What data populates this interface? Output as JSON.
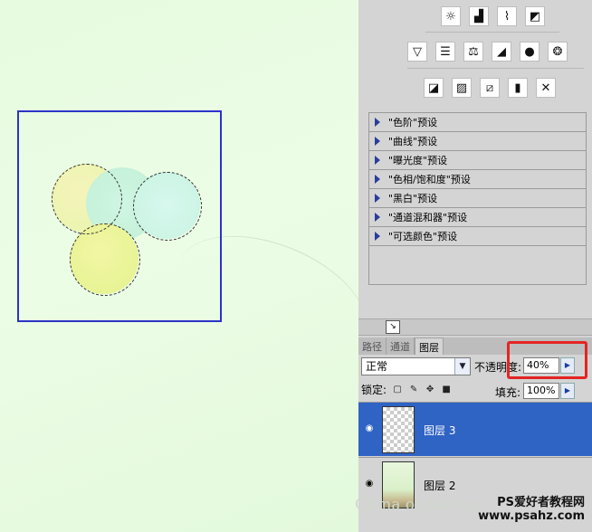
{
  "adjustments": {
    "row1_icons": [
      "brightness-icon",
      "levels-icon",
      "curves-icon",
      "exposure-icon"
    ],
    "row2_icons": [
      "vibrance-icon",
      "hue-saturation-icon",
      "color-balance-icon",
      "black-white-icon",
      "photo-filter-icon",
      "channel-mixer-icon"
    ],
    "row3_icons": [
      "invert-icon",
      "posterize-icon",
      "threshold-icon",
      "gradient-map-icon",
      "selective-color-icon"
    ],
    "presets": [
      "\"色阶\"预设",
      "\"曲线\"预设",
      "\"曝光度\"预设",
      "\"色相/饱和度\"预设",
      "\"黑白\"预设",
      "\"通道混和器\"预设",
      "\"可选颜色\"预设"
    ]
  },
  "layers_panel": {
    "tabs": [
      "路径",
      "通道",
      "图层"
    ],
    "active_tab": "图层",
    "blend_mode": "正常",
    "opacity_label": "不透明度:",
    "opacity_value": "40%",
    "lock_label": "锁定:",
    "fill_label": "填充:",
    "fill_value": "100%",
    "layers": [
      {
        "name": "图层 3",
        "selected": true
      },
      {
        "name": "图层 2",
        "selected": false
      }
    ]
  },
  "watermark": {
    "text": "China of pure c",
    "site_cn": "PS爱好者教程网",
    "site_url": "www.psahz.com"
  },
  "colors": {
    "selection_rect": "#2a34c8",
    "highlight_box": "#e32424",
    "selected_layer": "#2f63c4"
  }
}
